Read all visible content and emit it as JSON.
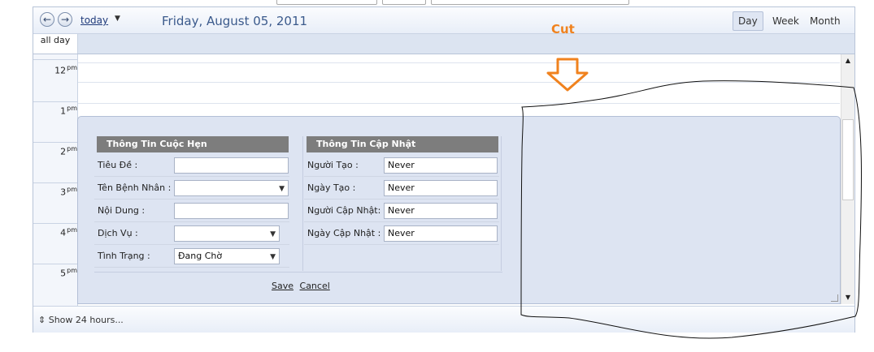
{
  "toolbar": {
    "today_label": "today",
    "date_title": "Friday, August 05, 2011",
    "views": [
      "Day",
      "Week",
      "Month"
    ],
    "active_view": "Day"
  },
  "allday_label": "all day",
  "hours": [
    {
      "num": "12",
      "suffix": "pm"
    },
    {
      "num": "1",
      "suffix": "pm"
    },
    {
      "num": "2",
      "suffix": "pm"
    },
    {
      "num": "3",
      "suffix": "pm"
    },
    {
      "num": "4",
      "suffix": "pm"
    },
    {
      "num": "5",
      "suffix": "pm"
    }
  ],
  "form": {
    "left_title": "Thông Tin Cuộc Hẹn",
    "right_title": "Thông Tin Cập Nhật",
    "left_fields": [
      {
        "label": "Tiêu Đề :",
        "value": ""
      },
      {
        "label": "Tên Bệnh Nhân :",
        "value": ""
      },
      {
        "label": "Nội Dung :",
        "value": ""
      },
      {
        "label": "Dịch Vụ :",
        "value": ""
      },
      {
        "label": "Tình Trạng :",
        "value": "Đang Chờ"
      }
    ],
    "right_fields": [
      {
        "label": "Người Tạo :",
        "value": "Never"
      },
      {
        "label": "Ngày Tạo :",
        "value": "Never"
      },
      {
        "label": "Người Cập Nhật:",
        "value": "Never"
      },
      {
        "label": "Ngày Cập Nhật :",
        "value": "Never"
      }
    ],
    "save_label": "Save",
    "cancel_label": "Cancel"
  },
  "footer": {
    "show_hours": "Show 24 hours..."
  },
  "annotation": {
    "text": "Cut",
    "color": "#f0821e"
  },
  "icons": {
    "prev": "arrow-left-icon",
    "next": "arrow-right-icon"
  }
}
